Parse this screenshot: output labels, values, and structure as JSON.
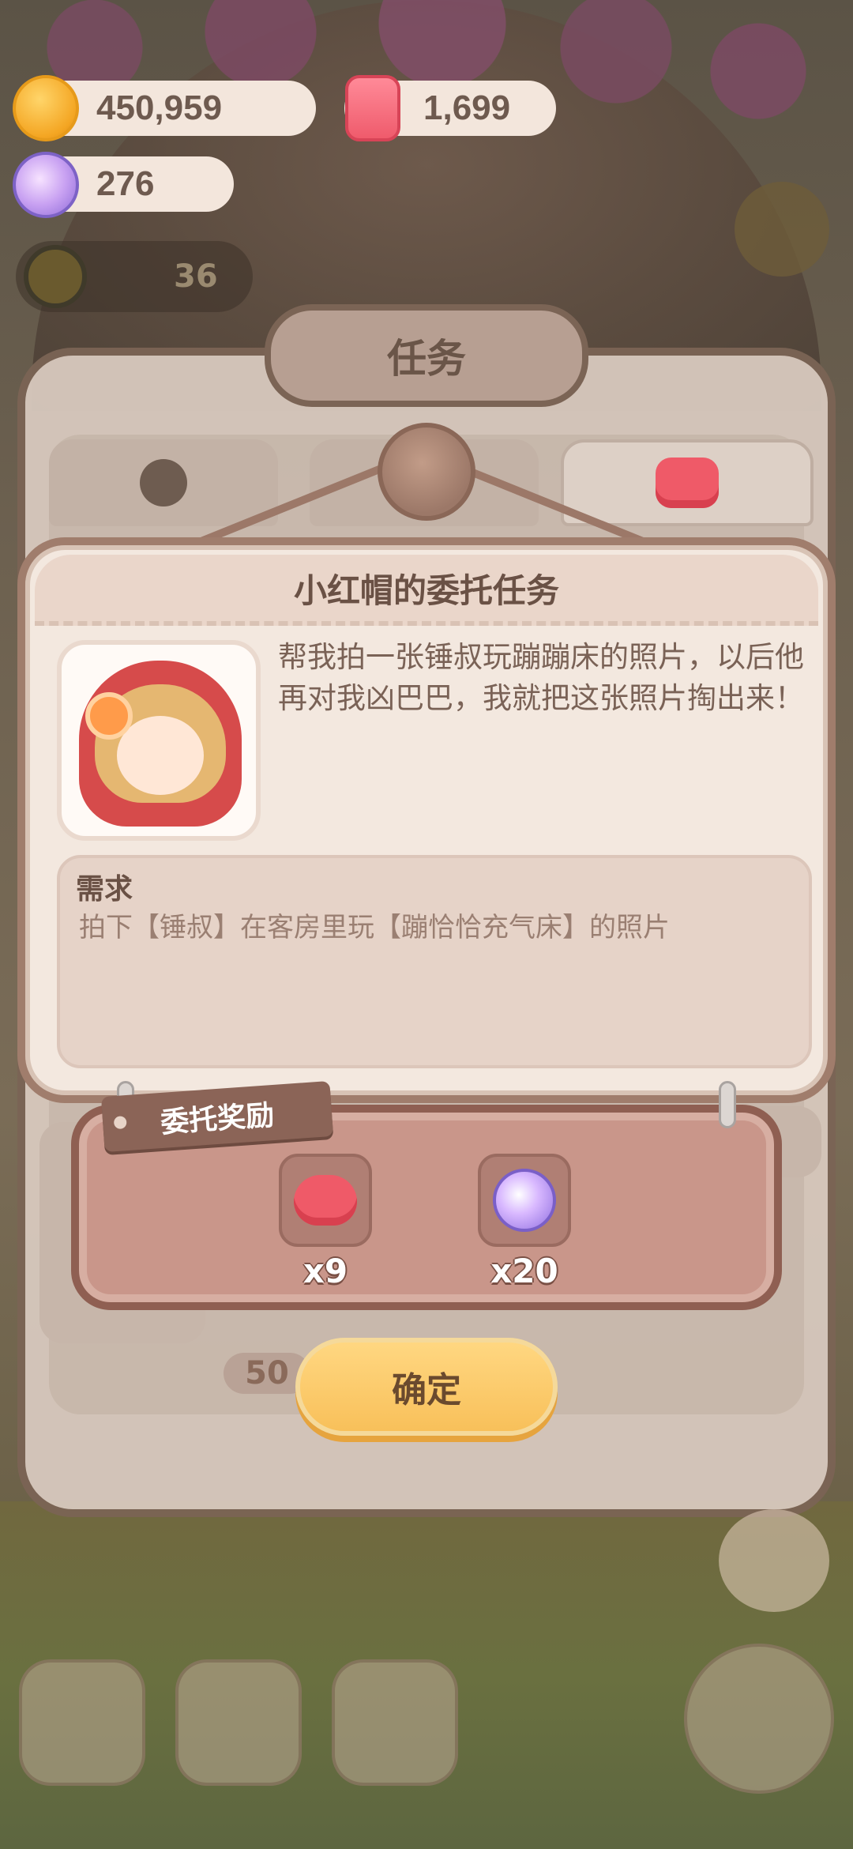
{
  "currencies": {
    "cookies": "450,959",
    "candles": "1,699",
    "candies": "276"
  },
  "side": {
    "level": "36"
  },
  "task_panel": {
    "title": "任务"
  },
  "dialog": {
    "title": "小红帽的委托任务",
    "description": "帮我拍一张锤叔玩蹦蹦床的照片，以后他再对我凶巴巴，我就把这张照片掏出来！",
    "requirement_title": "需求",
    "requirement_text": "拍下【锤叔】在客房里玩【蹦恰恰充气床】的照片"
  },
  "reward": {
    "label": "委托奖励",
    "items": [
      {
        "icon": "heart-icon",
        "count": "x9"
      },
      {
        "icon": "candy-icon",
        "count": "x20"
      }
    ]
  },
  "background_counter": "50",
  "confirm_label": "确定",
  "colors": {
    "accent": "#f8c05a",
    "dialog_bg": "#f3e8df",
    "reward_board": "#c9968a"
  }
}
